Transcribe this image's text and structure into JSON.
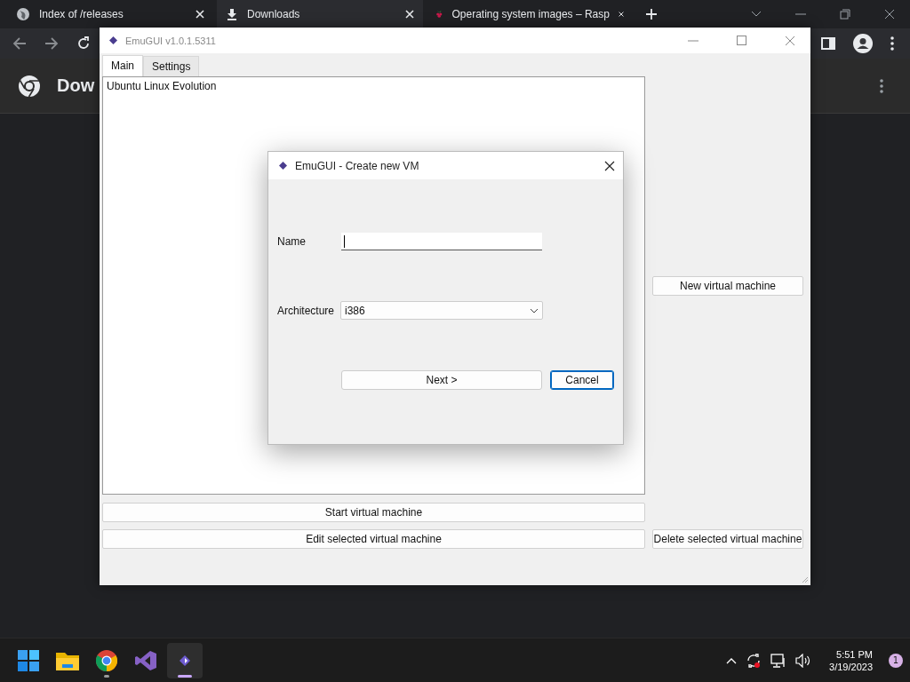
{
  "browser": {
    "tabs": [
      {
        "title": "Index of /releases",
        "kind": "globe",
        "selected": false
      },
      {
        "title": "Downloads",
        "kind": "download",
        "selected": true
      },
      {
        "title": "Operating system images – Rasp",
        "kind": "berry",
        "selected": false
      }
    ],
    "page_heading": "Dow"
  },
  "emugui": {
    "title": "EmuGUI v1.0.1.5311",
    "tabs": [
      {
        "label": "Main",
        "selected": true
      },
      {
        "label": "Settings",
        "selected": false
      }
    ],
    "vm_list": [
      "Ubuntu Linux Evolution"
    ],
    "new_button": "New virtual machine",
    "start_button": "Start virtual machine",
    "edit_button": "Edit selected virtual machine",
    "delete_button": "Delete selected virtual machine"
  },
  "dialog": {
    "title": "EmuGUI - Create new VM",
    "name_label": "Name",
    "name_focused": true,
    "architecture_label": "Architecture",
    "architecture": "i386",
    "buttons": [
      {
        "label": "Next >",
        "default": false
      },
      {
        "label": "Cancel",
        "default": true
      }
    ]
  },
  "taskbar": {
    "apps": [
      {
        "kind": "start",
        "running": false,
        "active": false
      },
      {
        "kind": "folder",
        "running": false,
        "active": false
      },
      {
        "kind": "chrome",
        "running": true,
        "active": false
      },
      {
        "kind": "studio",
        "running": false,
        "active": false
      },
      {
        "kind": "emugui",
        "running": true,
        "active": true
      }
    ],
    "time": "5:51 PM",
    "date": "3/19/2023",
    "notifications": "1"
  }
}
